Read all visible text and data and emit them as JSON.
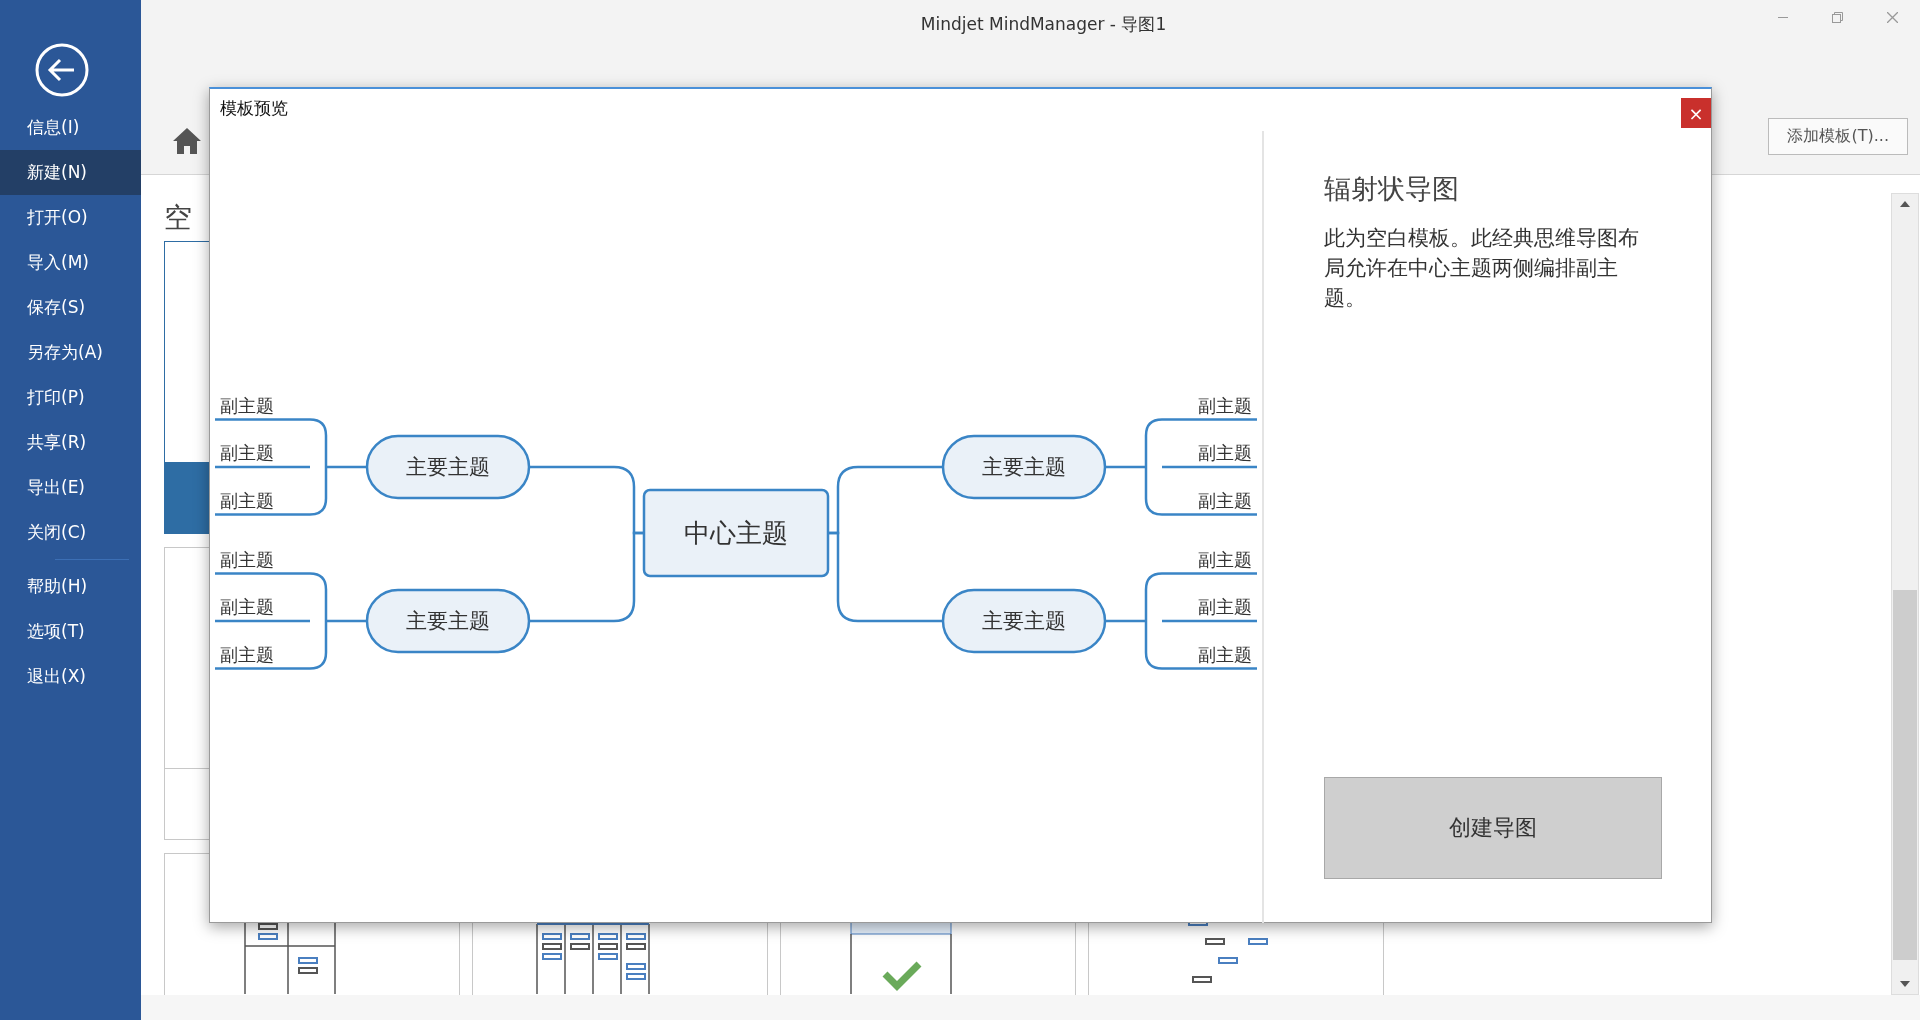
{
  "window": {
    "title": "Mindjet MindManager - 导图1"
  },
  "sidebar": {
    "groups": [
      {
        "items": [
          {
            "label": "信息(I)",
            "selected": false
          },
          {
            "label": "新建(N)",
            "selected": true
          },
          {
            "label": "打开(O)",
            "selected": false
          },
          {
            "label": "导入(M)",
            "selected": false
          },
          {
            "label": "保存(S)",
            "selected": false
          },
          {
            "label": "另存为(A)",
            "selected": false
          },
          {
            "label": "打印(P)",
            "selected": false
          },
          {
            "label": "共享(R)",
            "selected": false
          },
          {
            "label": "导出(E)",
            "selected": false
          },
          {
            "label": "关闭(C)",
            "selected": false
          }
        ]
      },
      {
        "items": [
          {
            "label": "帮助(H)",
            "selected": false
          },
          {
            "label": "选项(T)",
            "selected": false
          },
          {
            "label": "退出(X)",
            "selected": false
          }
        ]
      }
    ]
  },
  "toolbar": {
    "add_template_button": "添加模板(T)..."
  },
  "templates": {
    "heading": "空",
    "cards": [
      {
        "selected": true,
        "kind": "blank"
      },
      {
        "selected": false,
        "kind": "blank"
      },
      {
        "selected": false,
        "kind": "grid"
      },
      {
        "selected": false,
        "kind": "columns"
      },
      {
        "selected": false,
        "kind": "check"
      },
      {
        "selected": false,
        "kind": "tree"
      }
    ]
  },
  "dialog": {
    "title": "模板预览",
    "close": "×",
    "map": {
      "central": "中心主题",
      "branches": [
        {
          "label": "主要主题",
          "children": [
            {
              "label": "副主题"
            },
            {
              "label": "副主题"
            },
            {
              "label": "副主题"
            }
          ]
        },
        {
          "label": "主要主题",
          "children": [
            {
              "label": "副主题"
            },
            {
              "label": "副主题"
            },
            {
              "label": "副主题"
            }
          ]
        },
        {
          "label": "主要主题",
          "children": [
            {
              "label": "副主题"
            },
            {
              "label": "副主题"
            },
            {
              "label": "副主题"
            }
          ]
        },
        {
          "label": "主要主题",
          "children": [
            {
              "label": "副主题"
            },
            {
              "label": "副主题"
            },
            {
              "label": "副主题"
            }
          ]
        }
      ]
    },
    "template_name": "辐射状导图",
    "description": "此为空白模板。此经典思维导图布局允许在中心主题两侧编排副主题。",
    "create_button": "创建导图"
  }
}
